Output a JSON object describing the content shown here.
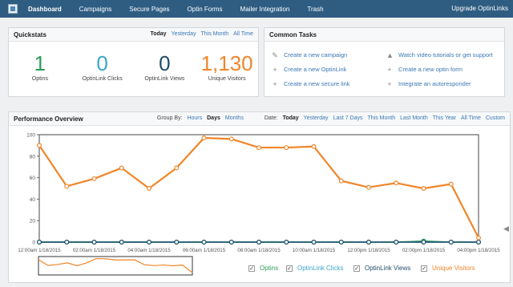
{
  "nav": {
    "items": [
      {
        "label": "Dashboard",
        "active": true
      },
      {
        "label": "Campaigns"
      },
      {
        "label": "Secure Pages"
      },
      {
        "label": "Optin Forms"
      },
      {
        "label": "Mailer Integration"
      },
      {
        "label": "Trash"
      }
    ],
    "right": "Upgrade OptinLinks"
  },
  "quickstats": {
    "title": "Quickstats",
    "ranges": [
      "Today",
      "Yesterday",
      "This Month",
      "All Time"
    ],
    "selected_range": "Today",
    "stats": [
      {
        "value": "1",
        "label": "Optins",
        "color": "#2e9e5b"
      },
      {
        "value": "0",
        "label": "OptinLink Clicks",
        "color": "#39a7c9"
      },
      {
        "value": "0",
        "label": "OptinLink Views",
        "color": "#1f4d6b"
      },
      {
        "value": "1,130",
        "label": "Unique Visitors",
        "color": "#f0862a"
      }
    ]
  },
  "tasks": {
    "title": "Common Tasks",
    "items": [
      {
        "label": "Create a new campaign",
        "icon": "edit-icon"
      },
      {
        "label": "Watch video tutorials or get support",
        "icon": "graduation-cap-icon"
      },
      {
        "label": "Create a new OptinLink",
        "icon": "plus-icon"
      },
      {
        "label": "Create a new optin form",
        "icon": "plus-icon"
      },
      {
        "label": "Create a new secure link",
        "icon": "plus-icon"
      },
      {
        "label": "Integrate an autoresponder",
        "icon": "plus-icon"
      }
    ]
  },
  "performance": {
    "title": "Performance Overview",
    "group_by_label": "Group By:",
    "group_by": [
      "Hours",
      "Days",
      "Months"
    ],
    "group_selected": "Days",
    "date_label": "Date:",
    "dates": [
      "Today",
      "Yesterday",
      "Last 7 Days",
      "This Month",
      "Last Month",
      "This Year",
      "All Time",
      "Custom"
    ],
    "date_selected": "Today"
  },
  "legend": [
    {
      "label": "Optins",
      "color": "#2e9e5b",
      "checked": true
    },
    {
      "label": "OptinLink Clicks",
      "color": "#39a7c9",
      "checked": true
    },
    {
      "label": "OptinLink Views",
      "color": "#1f4d6b",
      "checked": true
    },
    {
      "label": "Unique Visitors",
      "color": "#f0862a",
      "checked": true
    }
  ],
  "chart_data": {
    "type": "line",
    "x": [
      "12:00am 1/18/2015",
      "01:00am 1/18/2015",
      "02:00am 1/18/2015",
      "03:00am 1/18/2015",
      "04:00am 1/18/2015",
      "05:00am 1/18/2015",
      "06:00am 1/18/2015",
      "07:00am 1/18/2015",
      "08:00am 1/18/2015",
      "09:00am 1/18/2015",
      "10:00am 1/18/2015",
      "11:00am 1/18/2015",
      "12:00pm 1/18/2015",
      "01:00pm 1/18/2015",
      "02:00pm 1/18/2015",
      "03:00pm 1/18/2015",
      "04:00pm 1/18/2015"
    ],
    "tick_labels": [
      "12:00am 1/18/2015",
      "02:00am 1/18/2015",
      "04:00am 1/18/2015",
      "06:00am 1/18/2015",
      "08:00am 1/18/2015",
      "10:00am 1/18/2015",
      "12:00pm 1/18/2015",
      "02:00pm 1/18/2015",
      "04:00pm 1/18/2015"
    ],
    "yticks": [
      0,
      20,
      40,
      60,
      80,
      100
    ],
    "ylim": [
      0,
      100
    ],
    "series": [
      {
        "name": "Unique Visitors",
        "color": "#f0862a",
        "values": [
          90,
          52,
          59,
          69,
          50,
          69,
          97,
          96,
          88,
          88,
          89,
          57,
          51,
          55,
          50,
          54,
          4
        ]
      },
      {
        "name": "Optins",
        "color": "#2e9e5b",
        "values": [
          0,
          0,
          0,
          0,
          0,
          0,
          0,
          0,
          0,
          0,
          0,
          0,
          0,
          0,
          1,
          0,
          0
        ]
      },
      {
        "name": "OptinLink Clicks",
        "color": "#39a7c9",
        "values": [
          0,
          0,
          0,
          0,
          0,
          0,
          0,
          0,
          0,
          0,
          0,
          0,
          0,
          0,
          0,
          0,
          0
        ]
      },
      {
        "name": "OptinLink Views",
        "color": "#1f4d6b",
        "values": [
          0,
          0,
          0,
          0,
          0,
          0,
          0,
          0,
          0,
          0,
          0,
          0,
          0,
          0,
          0,
          0,
          0
        ]
      }
    ]
  }
}
